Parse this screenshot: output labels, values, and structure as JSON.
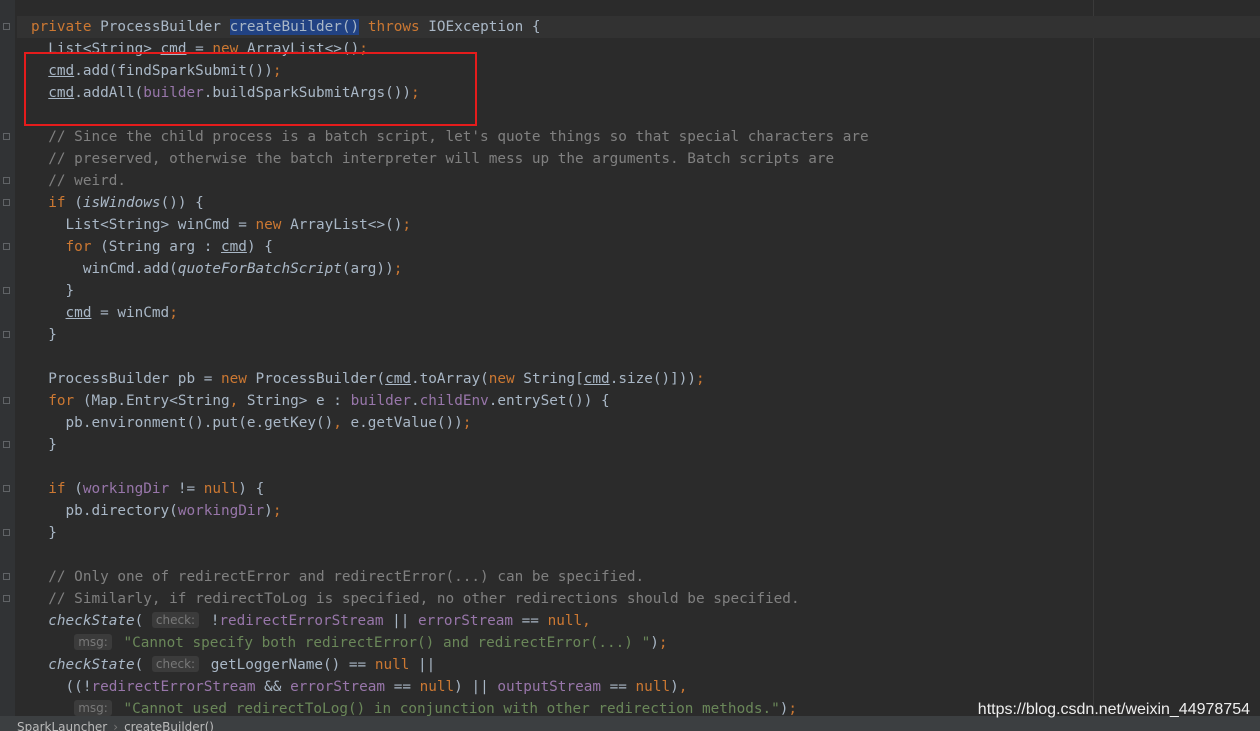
{
  "editor": {
    "watermark": "https://blog.csdn.net/weixin_44978754",
    "breadcrumb": [
      "SparkLauncher",
      "createBuilder()"
    ],
    "lines": [
      "private ProcessBuilder createBuilder() throws IOException {",
      "  List<String> cmd = new ArrayList<>();",
      "  cmd.add(findSparkSubmit());",
      "  cmd.addAll(builder.buildSparkSubmitArgs());",
      "",
      "  // Since the child process is a batch script, let's quote things so that special characters are",
      "  // preserved, otherwise the batch interpreter will mess up the arguments. Batch scripts are",
      "  // weird.",
      "  if (isWindows()) {",
      "    List<String> winCmd = new ArrayList<>();",
      "    for (String arg : cmd) {",
      "      winCmd.add(quoteForBatchScript(arg));",
      "    }",
      "    cmd = winCmd;",
      "  }",
      "",
      "  ProcessBuilder pb = new ProcessBuilder(cmd.toArray(new String[cmd.size()]));",
      "  for (Map.Entry<String, String> e : builder.childEnv.entrySet()) {",
      "    pb.environment().put(e.getKey(), e.getValue());",
      "  }",
      "",
      "  if (workingDir != null) {",
      "    pb.directory(workingDir);",
      "  }",
      "",
      "  // Only one of redirectError and redirectError(...) can be specified.",
      "  // Similarly, if redirectToLog is specified, no other redirections should be specified.",
      "  checkState( check: !redirectErrorStream || errorStream == null,",
      "     msg: \"Cannot specify both redirectError() and redirectError(...) \");",
      "  checkState( check: getLoggerName() == null ||",
      "    ((!redirectErrorStream && errorStream == null) || outputStream == null),",
      "     msg: \"Cannot used redirectToLog() in conjunction with other redirection methods.\");"
    ]
  }
}
